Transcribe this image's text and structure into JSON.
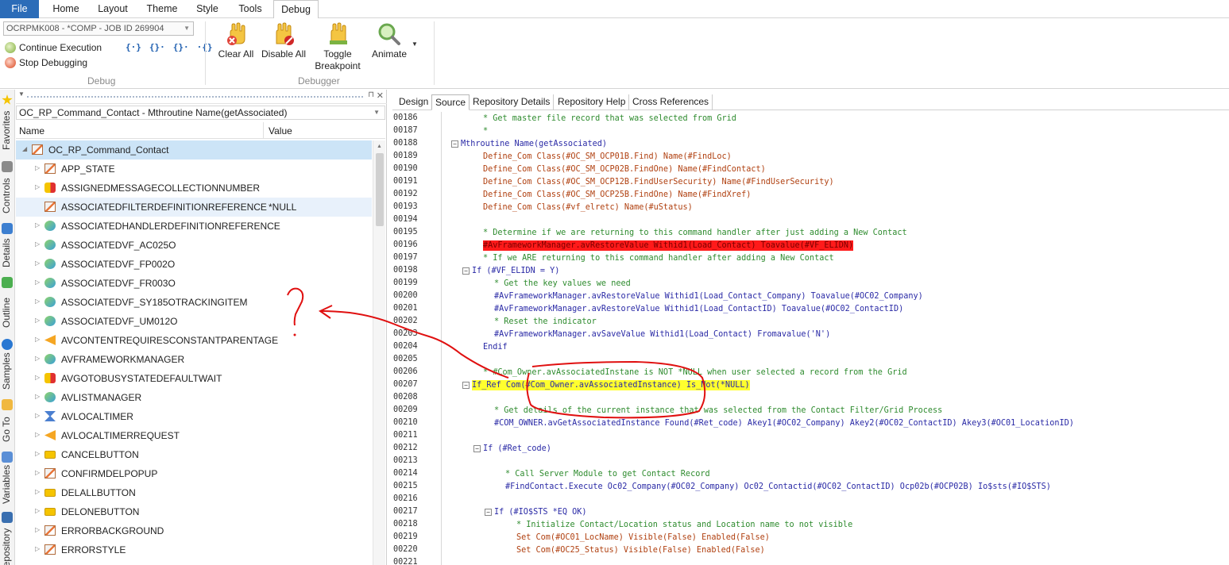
{
  "ribbon": {
    "tabs": [
      "File",
      "Home",
      "Layout",
      "Theme",
      "Style",
      "Tools",
      "Debug"
    ],
    "job_select": "OCRPMK008 - *COMP - JOB ID 269904",
    "continue_label": "Continue Execution",
    "stop_label": "Stop Debugging",
    "step_icons": [
      "{·}",
      "{}·",
      "{}·",
      "·{}"
    ],
    "debug_group": "Debug",
    "clear_all": "Clear All",
    "disable_all": "Disable All",
    "toggle_breakpoint_1": "Toggle",
    "toggle_breakpoint_2": "Breakpoint",
    "animate": "Animate",
    "debugger_group": "Debugger"
  },
  "side_tabs": [
    "Favorites",
    "Controls",
    "Details",
    "Outline",
    "Samples",
    "Go To",
    "Variables",
    "Repository"
  ],
  "tree": {
    "context": "OC_RP_Command_Contact - Mthroutine Name(getAssociated)",
    "col_name": "Name",
    "col_value": "Value",
    "rows": [
      {
        "label": "OC_RP_Command_Contact",
        "value": "",
        "icon": "component-icon",
        "expanded": true,
        "indent": 0
      },
      {
        "label": "APP_STATE",
        "value": "",
        "icon": "component-icon",
        "indent": 1
      },
      {
        "label": "ASSIGNEDMESSAGECOLLECTIONNUMBER",
        "value": "",
        "icon": "property-icon",
        "indent": 1
      },
      {
        "label": "ASSOCIATEDFILTERDEFINITIONREFERENCE",
        "value": "*NULL",
        "icon": "component-icon",
        "indent": 1,
        "noarrow": true
      },
      {
        "label": "ASSOCIATEDHANDLERDEFINITIONREFERENCE",
        "value": "",
        "icon": "object-icon",
        "indent": 1
      },
      {
        "label": "ASSOCIATEDVF_AC025O",
        "value": "",
        "icon": "object-icon",
        "indent": 1
      },
      {
        "label": "ASSOCIATEDVF_FP002O",
        "value": "",
        "icon": "object-icon",
        "indent": 1
      },
      {
        "label": "ASSOCIATEDVF_FR003O",
        "value": "",
        "icon": "object-icon",
        "indent": 1
      },
      {
        "label": "ASSOCIATEDVF_SY185OTRACKINGITEM",
        "value": "",
        "icon": "object-icon",
        "indent": 1
      },
      {
        "label": "ASSOCIATEDVF_UM012O",
        "value": "",
        "icon": "object-icon",
        "indent": 1
      },
      {
        "label": "AVCONTENTREQUIRESCONSTANTPARENTAGE",
        "value": "",
        "icon": "arrow-left-icon",
        "indent": 1
      },
      {
        "label": "AVFRAMEWORKMANAGER",
        "value": "",
        "icon": "object-icon",
        "indent": 1
      },
      {
        "label": "AVGOTOBUSYSTATEDEFAULTWAIT",
        "value": "",
        "icon": "property-icon",
        "indent": 1
      },
      {
        "label": "AVLISTMANAGER",
        "value": "",
        "icon": "object-icon",
        "indent": 1
      },
      {
        "label": "AVLOCALTIMER",
        "value": "",
        "icon": "hourglass-icon",
        "indent": 1
      },
      {
        "label": "AVLOCALTIMERREQUEST",
        "value": "",
        "icon": "arrow-left-icon",
        "indent": 1
      },
      {
        "label": "CANCELBUTTON",
        "value": "",
        "icon": "button-icon",
        "indent": 1
      },
      {
        "label": "CONFIRMDELPOPUP",
        "value": "",
        "icon": "component-icon",
        "indent": 1
      },
      {
        "label": "DELALLBUTTON",
        "value": "",
        "icon": "button-icon",
        "indent": 1
      },
      {
        "label": "DELONEBUTTON",
        "value": "",
        "icon": "button-icon",
        "indent": 1
      },
      {
        "label": "ERRORBACKGROUND",
        "value": "",
        "icon": "component-icon",
        "indent": 1
      },
      {
        "label": "ERRORSTYLE",
        "value": "",
        "icon": "component-icon",
        "indent": 1
      }
    ]
  },
  "editor": {
    "tabs": [
      "Design",
      "Source",
      "Repository Details",
      "Repository Help",
      "Cross References"
    ],
    "active_tab": "Source",
    "lines": [
      {
        "n": "00186",
        "indent": 2,
        "type": "com",
        "text": "* Get master file record that was selected from Grid"
      },
      {
        "n": "00187",
        "indent": 2,
        "type": "com",
        "text": "*"
      },
      {
        "n": "00188",
        "indent": 0,
        "type": "kw",
        "text": "Mthroutine Name(getAssociated)",
        "fold": true
      },
      {
        "n": "00189",
        "indent": 2,
        "type": "def",
        "text": "Define_Com Class(#OC_SM_OCP01B.Find) Name(#FindLoc)"
      },
      {
        "n": "00190",
        "indent": 2,
        "type": "def",
        "text": "Define_Com Class(#OC_SM_OCP02B.FindOne) Name(#FindContact)"
      },
      {
        "n": "00191",
        "indent": 2,
        "type": "def",
        "text": "Define_Com Class(#OC_SM_OCP12B.FindUserSecurity) Name(#FindUserSecurity)"
      },
      {
        "n": "00192",
        "indent": 2,
        "type": "def",
        "text": "Define_Com Class(#OC_SM_OCP25B.FindOne) Name(#FindXref)"
      },
      {
        "n": "00193",
        "indent": 2,
        "type": "def",
        "text": "Define_Com Class(#vf_elretc) Name(#uStatus)"
      },
      {
        "n": "00194",
        "indent": 2,
        "type": "com",
        "text": ""
      },
      {
        "n": "00195",
        "indent": 2,
        "type": "com",
        "text": "* Determine if we are returning to this command handler after just adding a New Contact"
      },
      {
        "n": "00196",
        "indent": 2,
        "type": "red",
        "text": "#AvFrameworkManager.avRestoreValue Withid1(Load_Contact) Toavalue(#VF_ELIDN)"
      },
      {
        "n": "00197",
        "indent": 2,
        "type": "com",
        "text": "* If we ARE returning to this command handler after adding a New Contact"
      },
      {
        "n": "00198",
        "indent": 1,
        "type": "kw",
        "text": "If (#VF_ELIDN = Y)",
        "fold": true
      },
      {
        "n": "00199",
        "indent": 3,
        "type": "com",
        "text": "* Get the key values we need"
      },
      {
        "n": "00200",
        "indent": 3,
        "type": "kw",
        "text": "#AvFrameworkManager.avRestoreValue Withid1(Load_Contact_Company) Toavalue(#OC02_Company)"
      },
      {
        "n": "00201",
        "indent": 3,
        "type": "kw",
        "text": "#AvFrameworkManager.avRestoreValue Withid1(Load_ContactID) Toavalue(#OC02_ContactID)"
      },
      {
        "n": "00202",
        "indent": 3,
        "type": "com",
        "text": "* Reset the indicator"
      },
      {
        "n": "00203",
        "indent": 3,
        "type": "kw",
        "text": "#AvFrameworkManager.avSaveValue Withid1(Load_Contact) Fromavalue('N')"
      },
      {
        "n": "00204",
        "indent": 2,
        "type": "kw",
        "text": "Endif"
      },
      {
        "n": "00205",
        "indent": 2,
        "type": "com",
        "text": ""
      },
      {
        "n": "00206",
        "indent": 2,
        "type": "com",
        "text": "* #Com_Owner.avAssociatedInstane is NOT *NULL when user selected a record from the Grid"
      },
      {
        "n": "00207",
        "indent": 1,
        "type": "yel",
        "text": "If_Ref Com(#Com_Owner.avAssociatedInstance) Is_Not(*NULL)",
        "fold": true
      },
      {
        "n": "00208",
        "indent": 2,
        "type": "com",
        "text": ""
      },
      {
        "n": "00209",
        "indent": 3,
        "type": "com",
        "text": "* Get details of the current instance that was selected from the Contact Filter/Grid Process"
      },
      {
        "n": "00210",
        "indent": 3,
        "type": "kw",
        "text": "#COM_OWNER.avGetAssociatedInstance Found(#Ret_code) Akey1(#OC02_Company) Akey2(#OC02_ContactID) Akey3(#OC01_LocationID)"
      },
      {
        "n": "00211",
        "indent": 3,
        "type": "com",
        "text": ""
      },
      {
        "n": "00212",
        "indent": 2,
        "type": "kw",
        "text": "If (#Ret_code)",
        "fold": true
      },
      {
        "n": "00213",
        "indent": 3,
        "type": "com",
        "text": ""
      },
      {
        "n": "00214",
        "indent": 4,
        "type": "com",
        "text": "* Call Server Module to get Contact Record"
      },
      {
        "n": "00215",
        "indent": 4,
        "type": "kw",
        "text": "#FindContact.Execute Oc02_Company(#OC02_Company) Oc02_Contactid(#OC02_ContactID) Ocp02b(#OCP02B) Io$sts(#IO$STS)"
      },
      {
        "n": "00216",
        "indent": 4,
        "type": "com",
        "text": ""
      },
      {
        "n": "00217",
        "indent": 3,
        "type": "kw",
        "text": "If (#IO$STS *EQ OK)",
        "fold": true
      },
      {
        "n": "00218",
        "indent": 5,
        "type": "com",
        "text": "* Initialize Contact/Location status and Location name to not visible"
      },
      {
        "n": "00219",
        "indent": 5,
        "type": "def",
        "text": "Set Com(#OC01_LocName) Visible(False) Enabled(False)"
      },
      {
        "n": "00220",
        "indent": 5,
        "type": "def",
        "text": "Set Com(#OC25_Status) Visible(False) Enabled(False)"
      },
      {
        "n": "00221",
        "indent": 5,
        "type": "com",
        "text": ""
      }
    ]
  },
  "annotation": {
    "mark": "?"
  },
  "colors": {
    "file_tab": "#2b6cb8",
    "selected_row": "#cce4f7",
    "breakpoint_line": "#ff1a1a",
    "current_line": "#ffff2e",
    "annotation": "#e01010"
  }
}
